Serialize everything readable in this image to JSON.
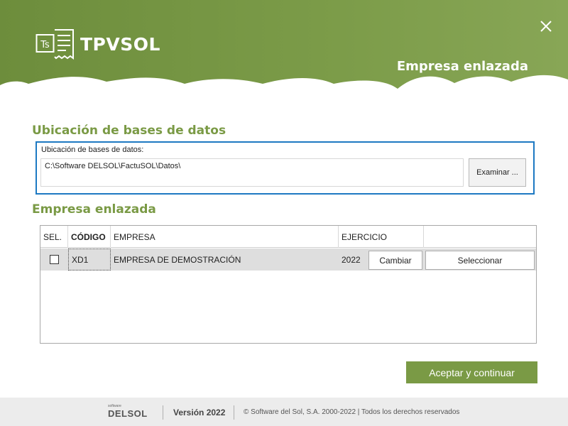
{
  "header": {
    "app_name": "TPVSOL",
    "logo_glyph": "Ts",
    "title": "Empresa enlazada",
    "background_color": "#7a9a45",
    "close_icon": "close-icon"
  },
  "db_section": {
    "title": "Ubicación de bases de datos",
    "field_label": "Ubicación de bases de datos:",
    "path_value": "C:\\Software DELSOL\\FactuSOL\\Datos\\",
    "browse_label": "Examinar ..."
  },
  "company_section": {
    "title": "Empresa enlazada",
    "columns": [
      "SEL.",
      "CÓDIGO",
      "EMPRESA",
      "EJERCICIO"
    ],
    "rows": [
      {
        "selected": false,
        "code": "XD1",
        "name": "EMPRESA DE DEMOSTRACIÓN",
        "year": "2022",
        "change_label": "Cambiar",
        "select_label": "Seleccionar"
      }
    ]
  },
  "actions": {
    "accept_label": "Aceptar y continuar"
  },
  "footer": {
    "brand_small": "software",
    "brand": "DELSOL",
    "version": "Versión 2022",
    "copyright": "© Software del Sol, S.A. 2000-2022  |  Todos los derechos reservados"
  },
  "colors": {
    "accent": "#7a9a45",
    "focus_border": "#1d79c2",
    "footer_bg": "#ececec"
  }
}
